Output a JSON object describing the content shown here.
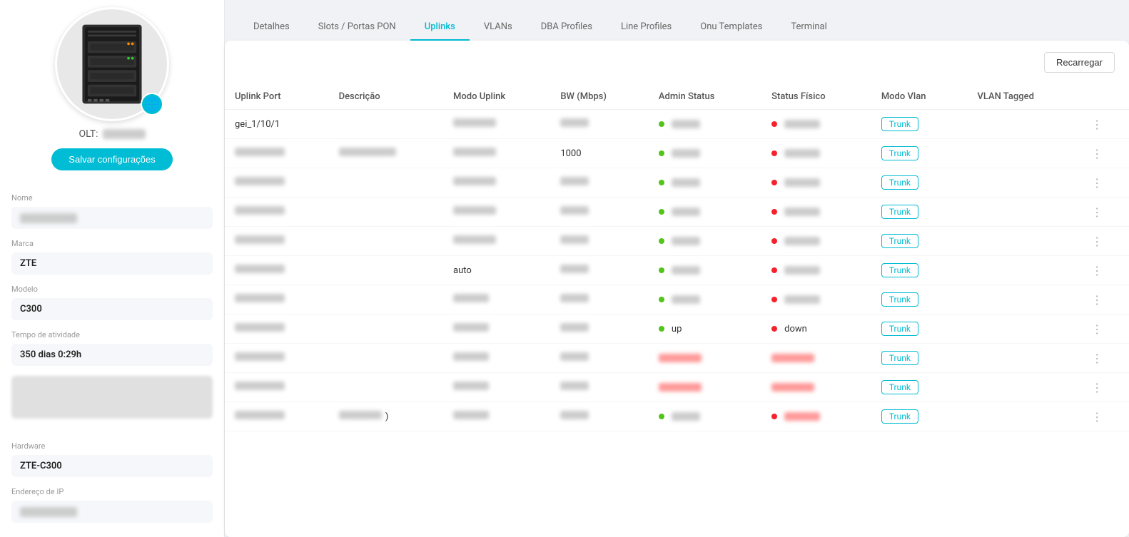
{
  "sidebar": {
    "olt_prefix": "OLT:",
    "save_button_label": "Salvar configurações",
    "nome_label": "Nome",
    "nome_value_blur": true,
    "marca_label": "Marca",
    "marca_value": "ZTE",
    "modelo_label": "Modelo",
    "modelo_value": "C300",
    "tempo_label": "Tempo de atividade",
    "tempo_value": "350 dias 0:29h",
    "hardware_label": "Hardware",
    "hardware_value": "ZTE-C300",
    "ip_label": "Endereço de IP",
    "ip_blur": true
  },
  "tabs": [
    {
      "label": "Detalhes",
      "active": false
    },
    {
      "label": "Slots / Portas PON",
      "active": false
    },
    {
      "label": "Uplinks",
      "active": true
    },
    {
      "label": "VLANs",
      "active": false
    },
    {
      "label": "DBA Profiles",
      "active": false
    },
    {
      "label": "Line Profiles",
      "active": false
    },
    {
      "label": "Onu Templates",
      "active": false
    },
    {
      "label": "Terminal",
      "active": false
    }
  ],
  "content": {
    "reload_label": "Recarregar",
    "columns": [
      "Uplink Port",
      "Descrição",
      "Modo Uplink",
      "BW (Mbps)",
      "Admin Status",
      "Status Físico",
      "Modo Vlan",
      "VLAN Tagged"
    ],
    "rows": [
      {
        "port": "gei_1/10/1",
        "descricao": "",
        "modo": "blur",
        "bw": "blur",
        "admin_status": "blur",
        "status_fisico": "blur",
        "modo_vlan": "Trunk",
        "vlan_tagged": ""
      },
      {
        "port": "blur",
        "descricao": "blur",
        "modo": "blur",
        "bw": "1000",
        "admin_status": "blur",
        "status_fisico": "blur",
        "modo_vlan": "Trunk",
        "vlan_tagged": ""
      },
      {
        "port": "blur",
        "descricao": "",
        "modo": "blur",
        "bw": "blur",
        "admin_status": "blur",
        "status_fisico": "blur",
        "modo_vlan": "Trunk",
        "vlan_tagged": ""
      },
      {
        "port": "blur",
        "descricao": "",
        "modo": "blur",
        "bw": "blur",
        "admin_status": "blur",
        "status_fisico": "blur",
        "modo_vlan": "Trunk",
        "vlan_tagged": ""
      },
      {
        "port": "blur",
        "descricao": "",
        "modo": "blur",
        "bw": "blur",
        "admin_status": "blur",
        "status_fisico": "blur",
        "modo_vlan": "Trunk",
        "vlan_tagged": ""
      },
      {
        "port": "blur",
        "descricao": "",
        "modo": "auto",
        "bw": "blur",
        "admin_status": "blur",
        "status_fisico": "blur",
        "modo_vlan": "Trunk",
        "vlan_tagged": ""
      },
      {
        "port": "blur",
        "descricao": "",
        "modo": "blur",
        "bw": "blur",
        "admin_status": "blur",
        "status_fisico": "blur",
        "modo_vlan": "Trunk",
        "vlan_tagged": ""
      },
      {
        "port": "blur",
        "descricao": "",
        "modo": "blur",
        "bw": "blur",
        "admin_status": "up",
        "admin_dot": "green",
        "status_fisico": "down",
        "status_dot": "red",
        "modo_vlan": "Trunk",
        "vlan_tagged": ""
      },
      {
        "port": "blur",
        "descricao": "",
        "modo": "blur",
        "bw": "blur",
        "admin_status": "blur",
        "status_fisico": "blur-red",
        "modo_vlan": "Trunk",
        "vlan_tagged": ""
      },
      {
        "port": "blur",
        "descricao": "",
        "modo": "blur",
        "bw": "blur",
        "admin_status": "blur",
        "status_fisico": "blur-red",
        "modo_vlan": "Trunk",
        "vlan_tagged": ""
      },
      {
        "port": "blur",
        "descricao": "blur-suffix",
        "modo": "blur",
        "bw": "blur",
        "admin_status": "blur",
        "status_fisico": "blur-red",
        "modo_vlan": "Trunk",
        "vlan_tagged": ""
      }
    ]
  },
  "icons": {
    "globe": "🌐",
    "dots": "⋮"
  }
}
